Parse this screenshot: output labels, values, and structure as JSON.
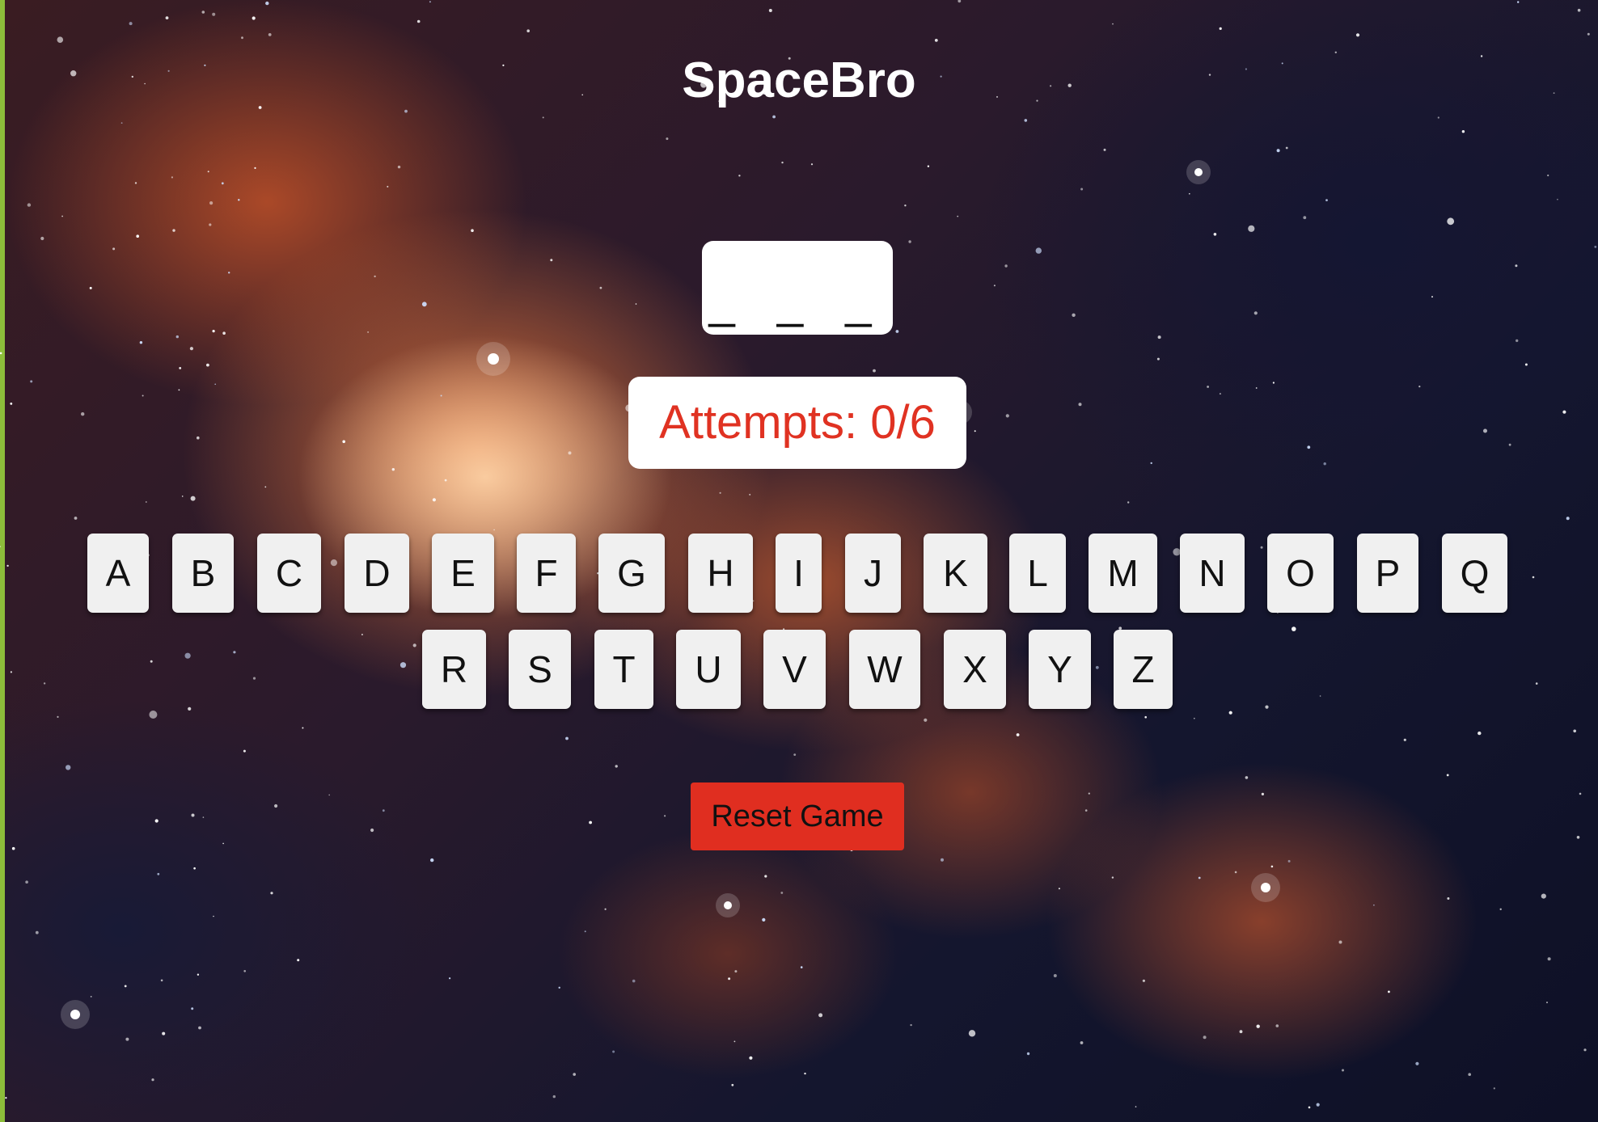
{
  "title": "SpaceBro",
  "word_display": "_ _ _",
  "attempts": {
    "text": "Attempts: 0/6",
    "used": 0,
    "max": 6
  },
  "keyboard": {
    "row1": [
      "A",
      "B",
      "C",
      "D",
      "E",
      "F",
      "G",
      "H",
      "I",
      "J",
      "K",
      "L",
      "M",
      "N",
      "O",
      "P",
      "Q"
    ],
    "row2": [
      "R",
      "S",
      "T",
      "U",
      "V",
      "W",
      "X",
      "Y",
      "Z"
    ]
  },
  "reset_label": "Reset Game",
  "colors": {
    "attempts_text": "#e03222",
    "reset_button": "#e02e20",
    "key_background": "#f0f0f0",
    "border_accent": "#8cbd3a"
  }
}
